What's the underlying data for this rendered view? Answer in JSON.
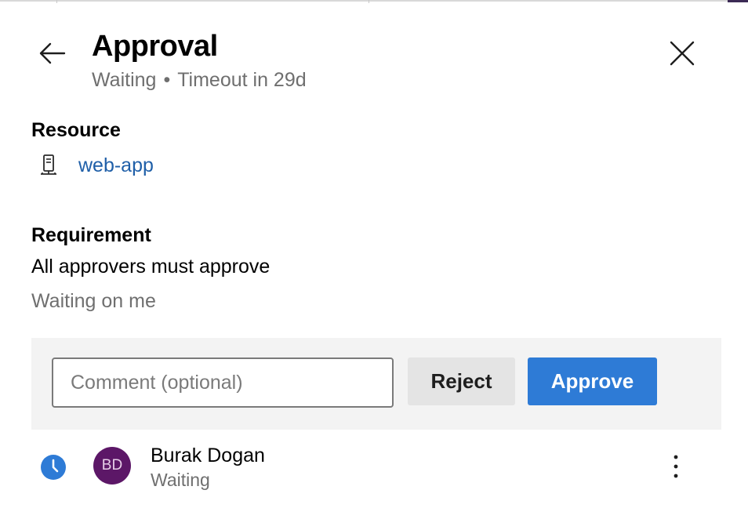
{
  "header": {
    "title": "Approval",
    "status": "Waiting",
    "separator": "•",
    "timeout": "Timeout in 29d"
  },
  "resource": {
    "heading": "Resource",
    "icon": "server-icon",
    "link_text": "web-app"
  },
  "requirement": {
    "heading": "Requirement",
    "text": "All approvers must approve",
    "waiting_text": "Waiting on me"
  },
  "actions": {
    "comment_value": "",
    "comment_placeholder": "Comment (optional)",
    "reject_label": "Reject",
    "approve_label": "Approve",
    "approve_color": "#2e7bd6",
    "reject_color": "#e4e4e4"
  },
  "approver": {
    "status_icon": "clock-icon",
    "status_icon_color": "#2e7bd6",
    "initials": "BD",
    "avatar_color": "#5c1767",
    "name": "Burak Dogan",
    "status": "Waiting"
  },
  "icons": {
    "back": "arrow-left-icon",
    "close": "close-icon",
    "more": "more-vertical-icon"
  }
}
